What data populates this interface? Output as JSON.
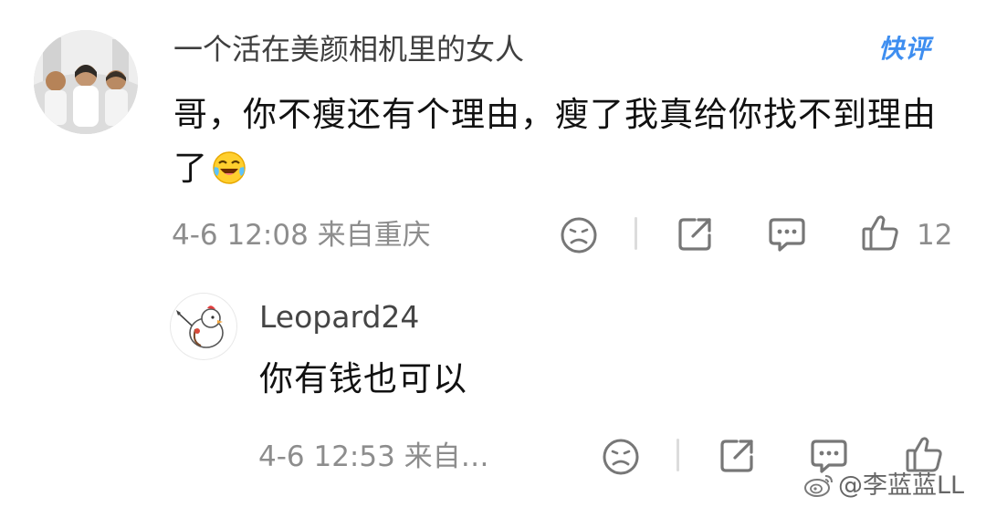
{
  "comment": {
    "username": "一个活在美颜相机里的女人",
    "badge": "快评",
    "text": "哥，你不瘦还有个理由，瘦了我真给你找不到理由了",
    "emoji": "laughing-crying-icon",
    "meta": "4-6 12:08  来自重庆",
    "likes": "12"
  },
  "reply": {
    "username": "Leopard24",
    "text": "你有钱也可以",
    "meta": "4-6 12:53  来自…"
  },
  "watermark": {
    "text": "@李蓝蓝LL"
  },
  "colors": {
    "text": "#111111",
    "meta": "#8d8d8d",
    "badge": "#3e8ef0",
    "icon": "#7b7b7b"
  }
}
